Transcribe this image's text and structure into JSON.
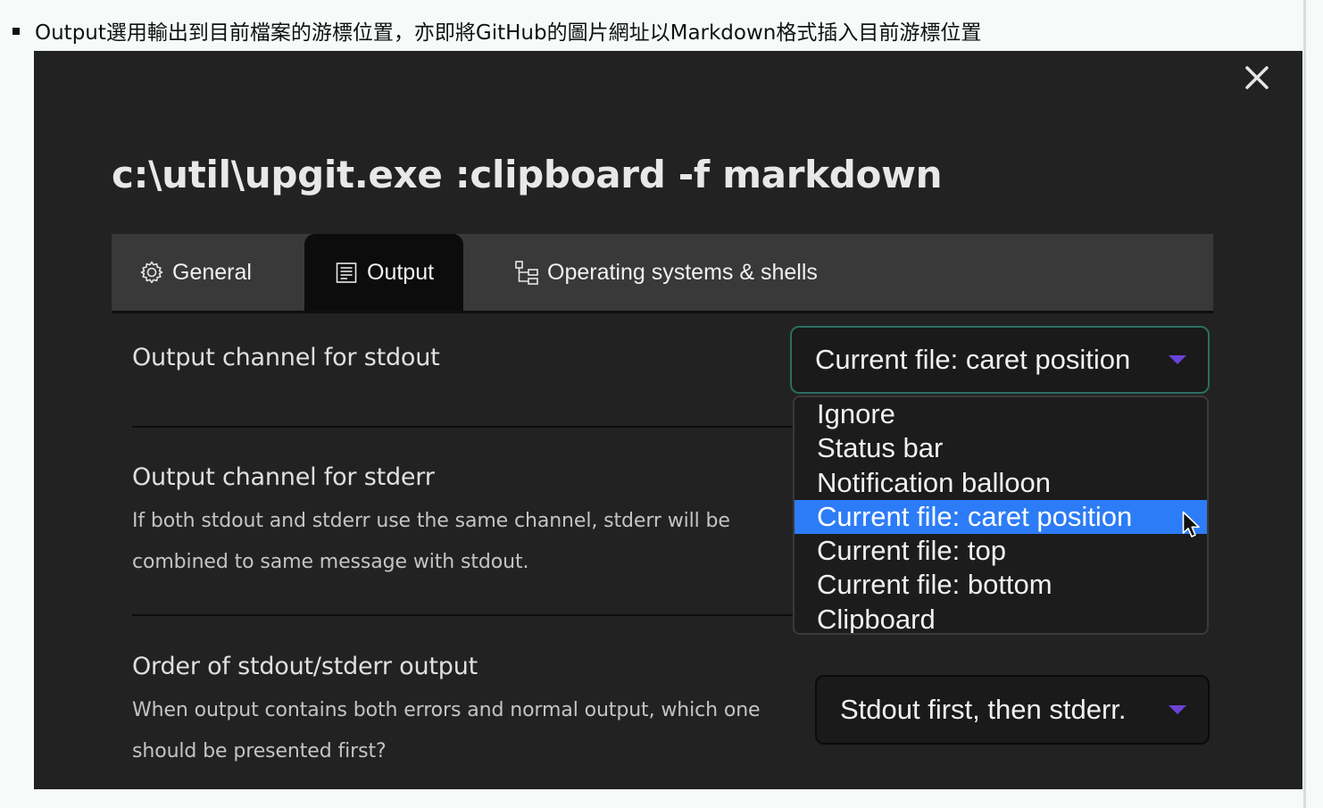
{
  "doc": {
    "bullet_text": "Output選用輸出到目前檔案的游標位置，亦即將GitHub的圖片網址以Markdown格式插入目前游標位置"
  },
  "dialog": {
    "title": "c:\\util\\upgit.exe :clipboard -f markdown",
    "close_icon": "close-icon",
    "tabs": [
      {
        "label": "General",
        "icon": "gear-icon",
        "active": false
      },
      {
        "label": "Output",
        "icon": "document-icon",
        "active": true
      },
      {
        "label": "Operating systems & shells",
        "icon": "tree-icon",
        "active": false
      }
    ]
  },
  "settings": {
    "stdout": {
      "label": "Output channel for stdout",
      "selected": "Current file: caret position",
      "options": [
        "Ignore",
        "Status bar",
        "Notification balloon",
        "Current file: caret position",
        "Current file: top",
        "Current file: bottom",
        "Clipboard"
      ],
      "highlighted_index": 3
    },
    "stderr": {
      "label": "Output channel for stderr",
      "description": "If both stdout and stderr use the same channel, stderr will be combined to same message with stdout."
    },
    "order": {
      "label": "Order of stdout/stderr output",
      "description": "When output contains both errors and normal output, which one should be presented first?",
      "selected": "Stdout first, then stderr."
    }
  },
  "colors": {
    "dialog_bg": "#222222",
    "tabbar_bg": "#393939",
    "active_tab_bg": "#0c0c0c",
    "highlight": "#2d7cf7",
    "caret_accent": "#6a43d8",
    "focus_border": "#2c6d62"
  }
}
